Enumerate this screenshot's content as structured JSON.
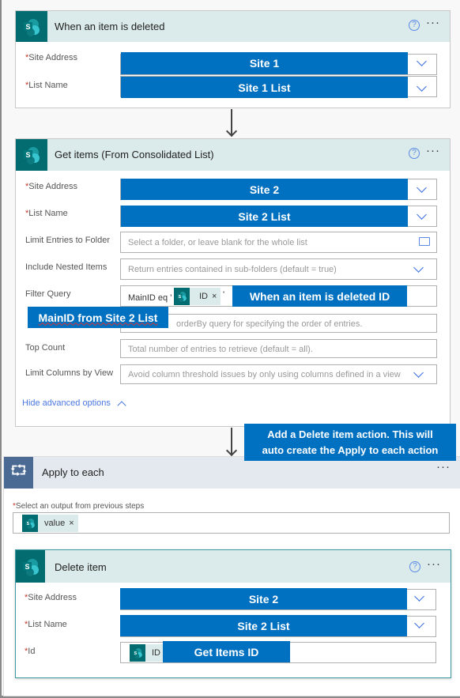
{
  "trigger": {
    "title": "When an item is deleted",
    "site_address_label": "Site Address",
    "site_address_value": "Site 1",
    "list_name_label": "List Name",
    "list_name_value": "Site 1 List"
  },
  "get_items": {
    "title": "Get items (From Consolidated List)",
    "site_address_label": "Site Address",
    "site_address_value": "Site 2",
    "list_name_label": "List Name",
    "list_name_value": "Site 2 List",
    "limit_folder_label": "Limit Entries to Folder",
    "limit_folder_placeholder": "Select a folder, or leave blank for the whole list",
    "nested_label": "Include Nested Items",
    "nested_placeholder": "Return entries contained in sub-folders (default = true)",
    "filter_label": "Filter Query",
    "filter_prefix": "MainID eq '",
    "filter_token": "ID",
    "filter_suffix": "'",
    "filter_callout": "When an item is deleted ID",
    "mainid_callout": "MainID from Site 2 List",
    "orderby_placeholder": "orderBy query for specifying the order of entries.",
    "top_label": "Top Count",
    "top_placeholder": "Total number of entries to retrieve (default = all).",
    "columns_label": "Limit Columns by View",
    "columns_placeholder": "Avoid column threshold issues by only using columns defined in a view",
    "hide_advanced": "Hide advanced options"
  },
  "callout": {
    "line1": "Add a Delete item action.  This will",
    "line2": "auto create the Apply to each action"
  },
  "apply": {
    "title": "Apply to each",
    "output_label": "Select an output from previous steps",
    "token": "value"
  },
  "delete": {
    "title": "Delete item",
    "site_address_label": "Site Address",
    "site_address_value": "Site 2",
    "list_name_label": "List Name",
    "list_name_value": "Site 2 List",
    "id_label": "Id",
    "id_token": "ID",
    "id_callout": "Get Items ID"
  },
  "icons": {
    "help": "?",
    "more": "···",
    "remove": "×"
  },
  "colors": {
    "callout": "#0070c0",
    "sharepoint": "#036c70",
    "header": "#dbeaea"
  }
}
